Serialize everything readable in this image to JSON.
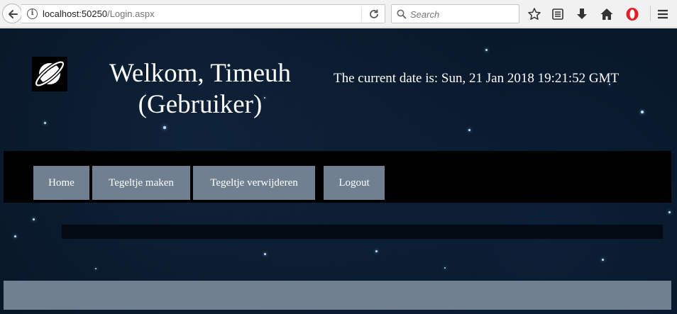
{
  "browser": {
    "url_host": "localhost:50250",
    "url_path": "/Login.aspx",
    "search_placeholder": "Search"
  },
  "header": {
    "title_line1": "Welkom, Timeuh",
    "title_line2": "(Gebruiker)",
    "date_text": "The current date is: Sun, 21 Jan 2018 19:21:52 GMT"
  },
  "nav": {
    "items": [
      {
        "label": "Home"
      },
      {
        "label": "Tegeltje maken"
      },
      {
        "label": "Tegeltje verwijderen"
      },
      {
        "label": "Logout"
      }
    ]
  },
  "colors": {
    "nav_button": "#708090",
    "navbar": "#000000",
    "background": "#071524"
  }
}
